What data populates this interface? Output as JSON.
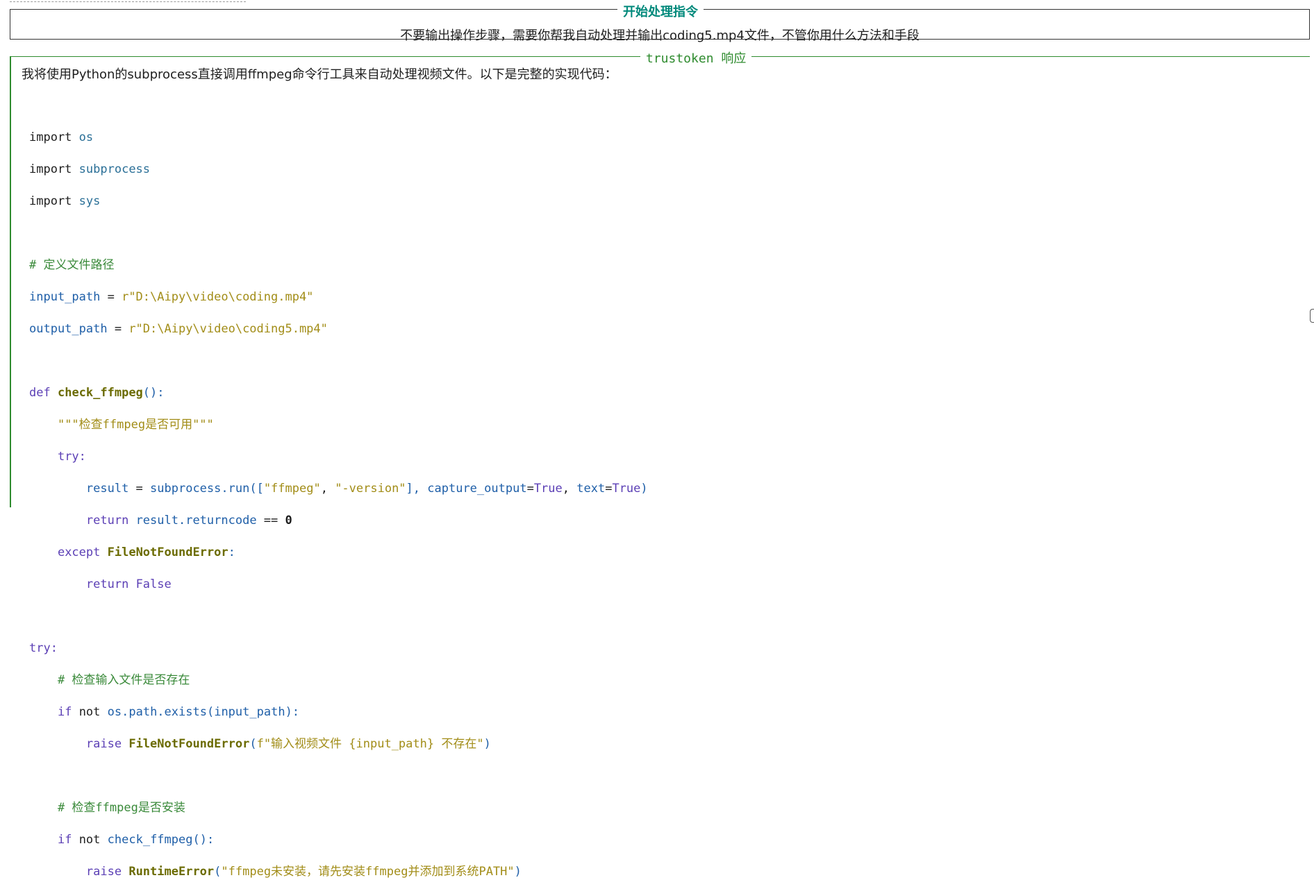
{
  "instruction_panel": {
    "title": "开始处理指令",
    "text": "不要输出操作步骤，需要你帮我自动处理并输出coding5.mp4文件，不管你用什么方法和手段"
  },
  "response_panel": {
    "title": "trustoken 响应",
    "intro": "我将使用Python的subprocess直接调用ffmpeg命令行工具来自动处理视频文件。以下是完整的实现代码："
  },
  "code": {
    "import_kw": "import",
    "mod_os": "os",
    "mod_subprocess": "subprocess",
    "mod_sys": "sys",
    "comment_paths": "# 定义文件路径",
    "input_var": "input_path",
    "input_val": "r\"D:\\Aipy\\video\\coding.mp4\"",
    "output_var": "output_path",
    "output_val": "r\"D:\\Aipy\\video\\coding5.mp4\"",
    "def_kw": "def",
    "fn_check": "check_ffmpeg",
    "docstring": "\"\"\"检查ffmpeg是否可用\"\"\"",
    "try_kw": "try:",
    "result_line_a": "result",
    "subprocess_run": "subprocess.run",
    "arg_ffmpeg": "\"ffmpeg\"",
    "arg_version": "\"-version\"",
    "capture_output": "capture_output",
    "text_kw": "text",
    "true_val": "True",
    "return_kw": "return",
    "returncode": "result.returncode",
    "zero": "0",
    "except_kw": "except",
    "fnf_error": "FileNotFoundError",
    "false_val": "False",
    "comment_check_input": "# 检查输入文件是否存在",
    "if_kw": "if",
    "not_kw": "not",
    "os_path_exists": "os.path.exists",
    "raise_kw": "raise",
    "fnf_msg": "f\"输入视频文件 {input_path} 不存在\"",
    "comment_check_ffmpeg": "# 检查ffmpeg是否安装",
    "runtime_error": "RuntimeError",
    "runtime_msg": "\"ffmpeg未安装，请先安装ffmpeg并添加到系统PATH\""
  }
}
